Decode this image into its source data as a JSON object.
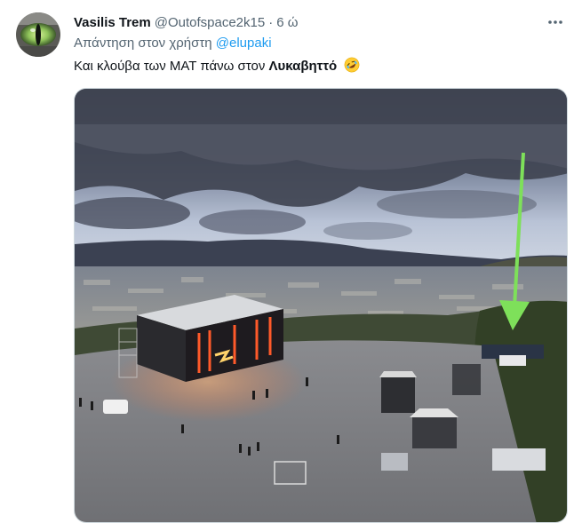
{
  "tweet": {
    "display_name": "Vasilis Trem",
    "handle": "@Outofspace2k15",
    "separator": "·",
    "time": "6 ώ",
    "reply_prefix": "Απάντηση στον χρήστη",
    "reply_mention": "@elupaki",
    "text_plain": "Και κλούβα των ΜΑΤ πάνω στον",
    "text_bold": "Λυκαβηττό",
    "emoji": "rolling-on-floor-laughing-emoji"
  },
  "icons": {
    "more": "more-horizontal-icon",
    "avatar": "cat-eye-avatar"
  },
  "colors": {
    "link": "#1d9bf0",
    "secondary_text": "#536471",
    "primary_text": "#0f1419",
    "arrow": "#7ee05a"
  },
  "media": {
    "description": "aerial-photo-stage-on-hill"
  }
}
